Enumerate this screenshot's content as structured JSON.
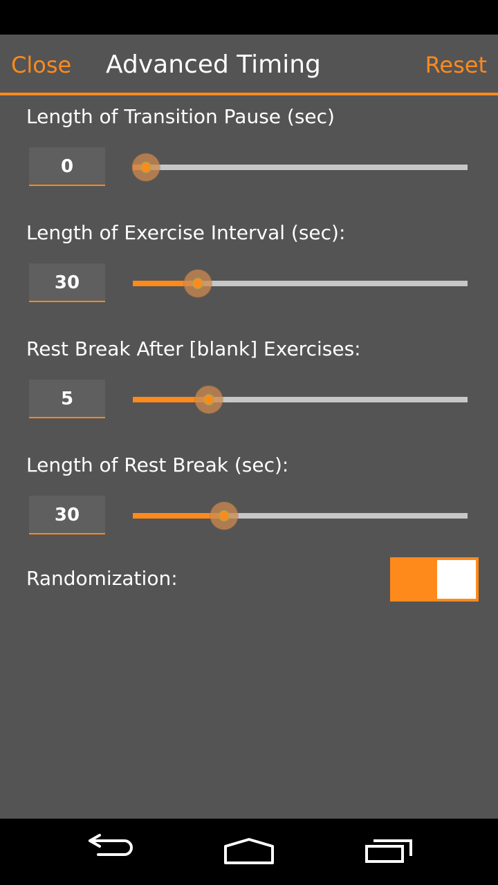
{
  "header": {
    "close_label": "Close",
    "title": "Advanced Timing",
    "reset_label": "Reset"
  },
  "settings": [
    {
      "label": "Length of Transition Pause (sec)",
      "value": "0",
      "slider_fraction": 0.04
    },
    {
      "label": "Length of Exercise Interval (sec):",
      "value": "30",
      "slider_fraction": 0.195
    },
    {
      "label": "Rest Break After [blank] Exercises:",
      "value": "5",
      "slider_fraction": 0.227
    },
    {
      "label": "Length of Rest Break (sec):",
      "value": "30",
      "slider_fraction": 0.273
    }
  ],
  "randomization": {
    "label": "Randomization:",
    "state": "on"
  },
  "colors": {
    "accent": "#ff8a1c",
    "background": "#545454",
    "track": "#c7c7c7"
  },
  "nav": {
    "back_icon": "back-arrow-icon",
    "home_icon": "home-icon",
    "recents_icon": "recent-apps-icon"
  }
}
